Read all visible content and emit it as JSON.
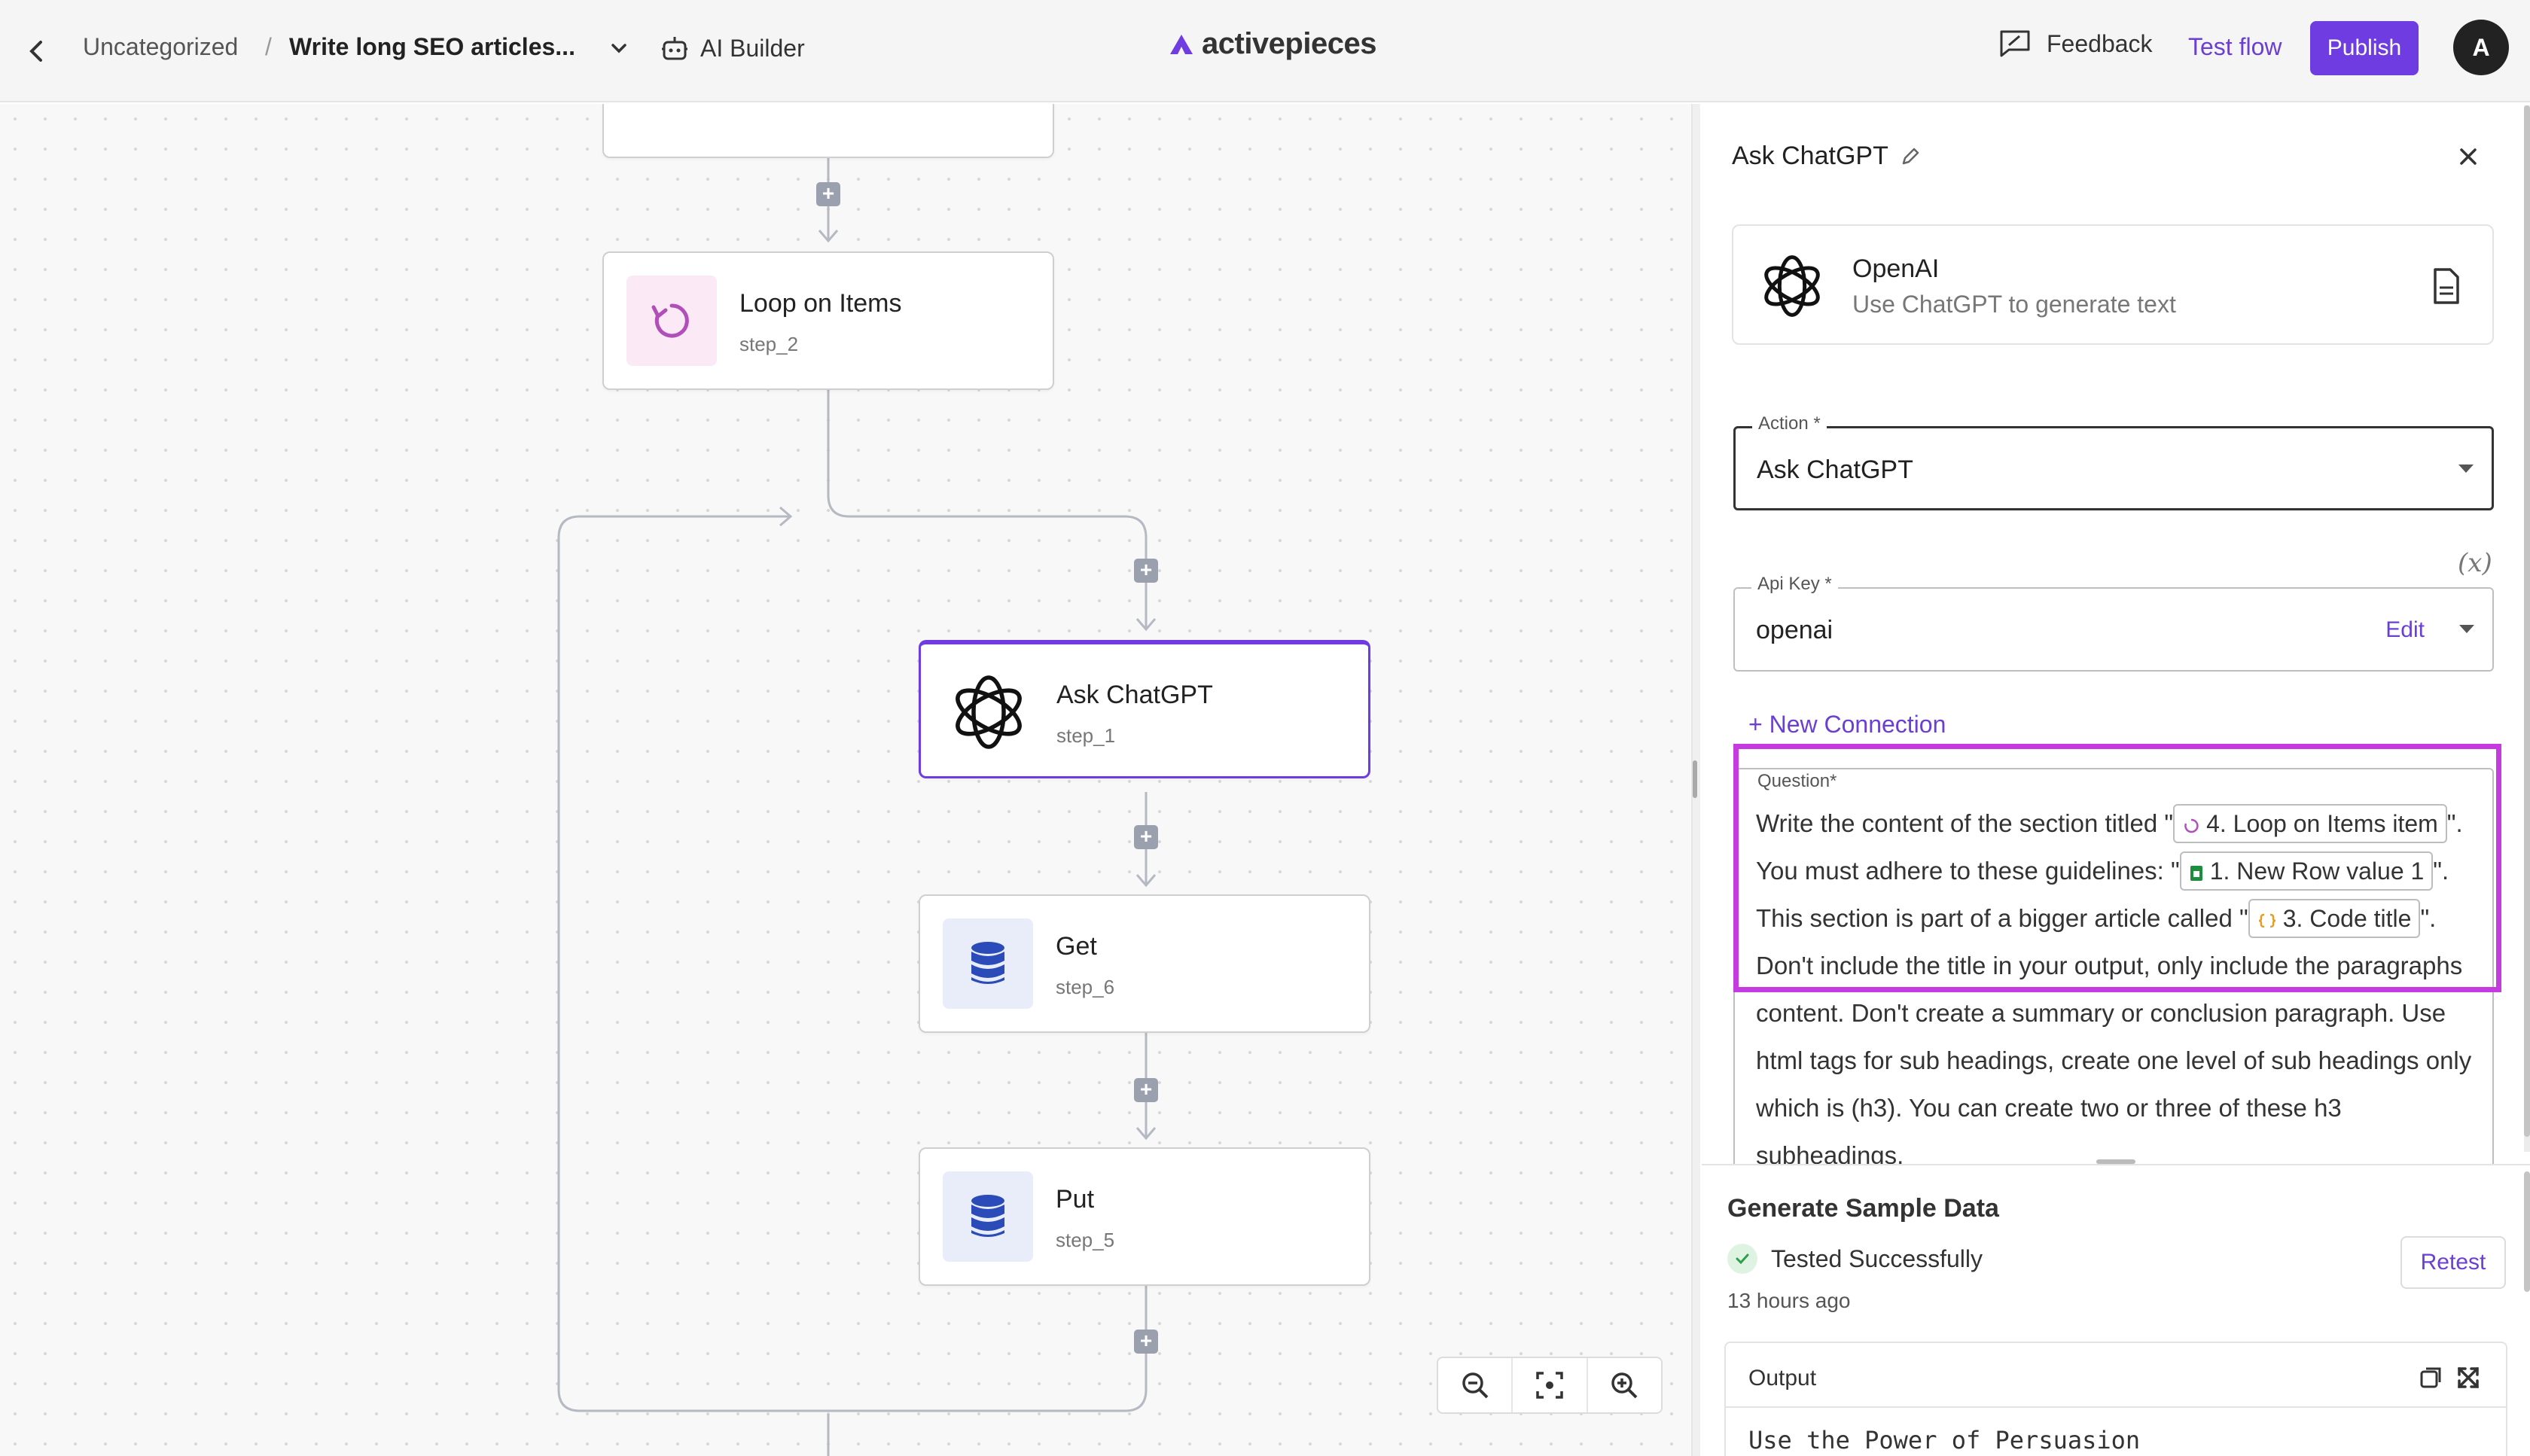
{
  "header": {
    "breadcrumb_folder": "Uncategorized",
    "breadcrumb_sep": "/",
    "flow_name": "Write long SEO articles...",
    "ai_builder_label": "AI Builder",
    "logo_text": "activepieces",
    "feedback_label": "Feedback",
    "test_flow_label": "Test flow",
    "publish_label": "Publish",
    "avatar_initial": "A",
    "accent_color": "#6e3ce0"
  },
  "canvas": {
    "nodes": [
      {
        "title": "Loop on Items",
        "step": "step_2",
        "icon": "loop-icon"
      },
      {
        "title": "Ask ChatGPT",
        "step": "step_1",
        "icon": "openai-icon",
        "selected": true
      },
      {
        "title": "Get",
        "step": "step_6",
        "icon": "database-icon"
      },
      {
        "title": "Put",
        "step": "step_5",
        "icon": "database-icon"
      }
    ],
    "zoom_controls": [
      "zoom-out-icon",
      "fit-view-icon",
      "zoom-in-icon"
    ]
  },
  "panel": {
    "title": "Ask ChatGPT",
    "piece": {
      "name": "OpenAI",
      "description": "Use ChatGPT to generate text"
    },
    "action": {
      "label": "Action *",
      "value": "Ask ChatGPT"
    },
    "api_key": {
      "label": "Api Key *",
      "value": "openai",
      "edit_label": "Edit"
    },
    "fx_label": "(x)",
    "new_connection_label": "+ New Connection",
    "question": {
      "label": "Question*",
      "t1": "Write the content of the section titled \"",
      "chip1": "4. Loop on Items item",
      "t2": "\". You must adhere to these guidelines: \"",
      "chip2": "1. New Row value 1",
      "t3": "\". This section is part of a bigger article called \"",
      "chip3": "3. Code title",
      "t4": "\". Don't include the title in your output, only include the paragraphs content. Don't create a summary or conclusion paragraph. Use html tags for sub headings, create one level of sub headings only which is (h3). You can create two or three of these h3 subheadings."
    },
    "sample": {
      "title": "Generate Sample Data",
      "status": "Tested Successfully",
      "time": "13 hours ago",
      "retest_label": "Retest",
      "output_label": "Output",
      "output_text": "Use the Power of Persuasion"
    }
  }
}
